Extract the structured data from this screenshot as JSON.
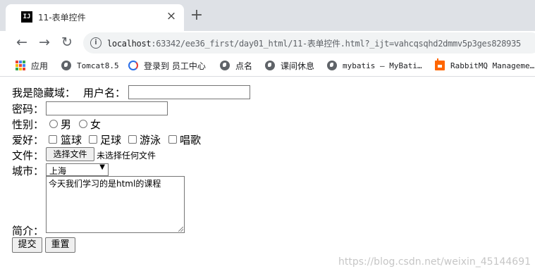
{
  "tab": {
    "favicon_text": "IJ",
    "title": "11-表单控件",
    "close": "×",
    "new_tab": "+"
  },
  "toolbar": {
    "back": "←",
    "forward": "→",
    "reload": "↻",
    "info": "i",
    "url_host": "localhost",
    "url_rest": ":63342/ee36_first/day01_html/11-表单控件.html?_ijt=vahcqsqhd2dmmv5p3ges828935"
  },
  "bookmarks": [
    {
      "label": "应用",
      "icon": "apps-icon"
    },
    {
      "label": "Tomcat8.5",
      "icon": "globe-icon"
    },
    {
      "label": "登录到 员工中心",
      "icon": "swirl-icon"
    },
    {
      "label": "点名",
      "icon": "globe-icon"
    },
    {
      "label": "课间休息",
      "icon": "globe-icon"
    },
    {
      "label": "mybatis – MyBati…",
      "icon": "globe-icon"
    },
    {
      "label": "RabbitMQ Manageme…",
      "icon": "rabbit-icon"
    }
  ],
  "form": {
    "hidden_label": "我是隐藏域：",
    "username_label": "用户名：",
    "username_value": "",
    "password_label": "密码：",
    "password_value": "",
    "gender_label": "性别：",
    "gender_male": "男",
    "gender_female": "女",
    "hobby_label": "爱好：",
    "hobby_basketball": "篮球",
    "hobby_football": "足球",
    "hobby_swim": "游泳",
    "hobby_sing": "唱歌",
    "file_label": "文件：",
    "file_button": "选择文件",
    "file_status": "未选择任何文件",
    "city_label": "城市：",
    "city_value": "上海",
    "intro_label": "简介：",
    "intro_value": "今天我们学习的是html的课程",
    "submit": "提交",
    "reset": "重置"
  },
  "watermark": "https://blog.csdn.net/weixin_45144691"
}
